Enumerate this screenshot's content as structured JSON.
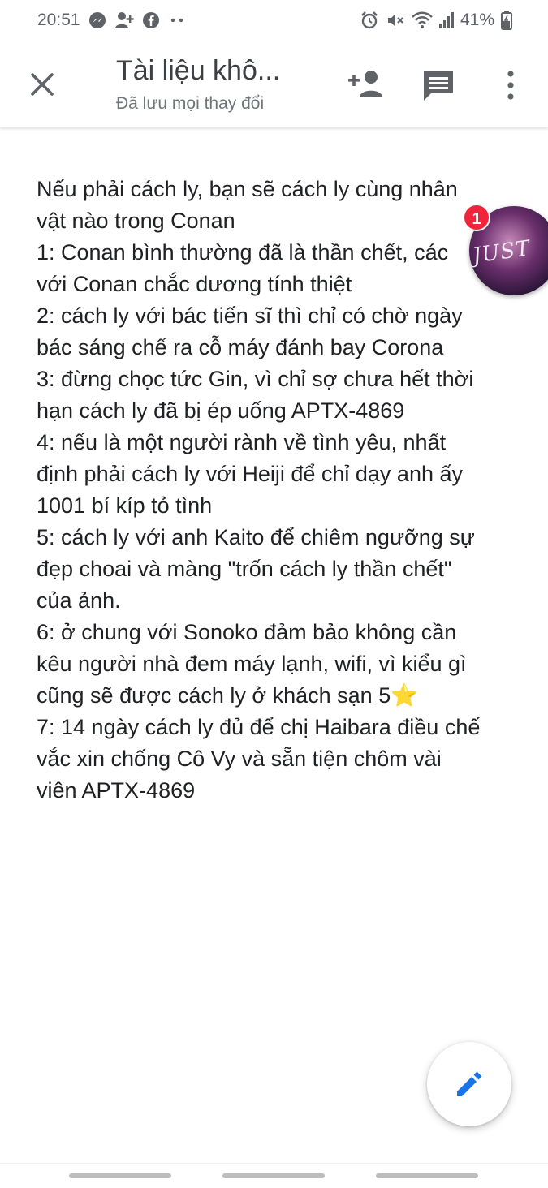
{
  "status_bar": {
    "time": "20:51",
    "left_icons": [
      "messenger-icon",
      "add-friend-icon",
      "facebook-icon",
      "more-dots-icon"
    ],
    "right_icons": [
      "alarm-icon",
      "mute-icon",
      "wifi-icon",
      "signal-icon",
      "battery-icon"
    ],
    "battery": "41%"
  },
  "toolbar": {
    "title": "Tài liệu khô...",
    "subtitle": "Đã lưu mọi thay đổi"
  },
  "document": {
    "lines": [
      "Nếu phải cách ly, bạn sẽ cách ly cùng nhân",
      "vật nào trong Conan",
      "1: Conan bình thường đã là thần chết, các",
      "với Conan chắc dương tính thiệt",
      "2: cách ly với bác tiến sĩ thì chỉ có chờ ngày",
      "bác sáng chế ra cỗ máy đánh bay Corona",
      "3: đừng chọc tức Gin, vì chỉ sợ chưa hết thời",
      "hạn cách ly đã bị ép uống APTX-4869",
      "4: nếu là một người rành về tình yêu, nhất",
      "định phải cách ly với Heiji để chỉ dạy anh ấy",
      "1001 bí kíp tỏ tình",
      "5: cách ly với anh Kaito để chiêm ngưỡng sự",
      "đẹp choai và màng \"trốn cách ly thần chết\"",
      "của ảnh.",
      "6: ở chung với Sonoko đảm bảo không cần",
      "kêu người nhà đem máy lạnh, wifi, vì kiểu gì",
      "cũng sẽ được cách ly ở khách sạn 5⭐",
      "7: 14 ngày cách ly đủ để chị Haibara điều chế",
      "vắc xin chống Cô Vy và sẵn tiện chôm vài",
      "viên APTX-4869"
    ]
  },
  "chat_head": {
    "badge_count": "1",
    "image_text": "JUST"
  },
  "colors": {
    "accent": "#1a73e8",
    "badge": "#f0243a",
    "icon": "#5f6368"
  }
}
